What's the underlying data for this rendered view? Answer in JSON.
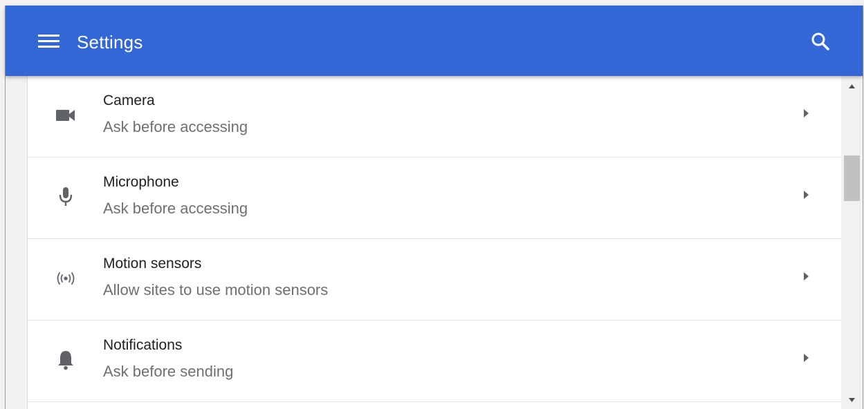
{
  "appbar": {
    "title": "Settings",
    "menu_icon": "hamburger-menu-icon",
    "search_icon": "search-icon",
    "color": "#3367d6"
  },
  "settings": [
    {
      "title": "Camera",
      "subtitle": "Ask before accessing",
      "icon": "camera-icon"
    },
    {
      "title": "Microphone",
      "subtitle": "Ask before accessing",
      "icon": "microphone-icon"
    },
    {
      "title": "Motion sensors",
      "subtitle": "Allow sites to use motion sensors",
      "icon": "motion-sensors-icon"
    },
    {
      "title": "Notifications",
      "subtitle": "Ask before sending",
      "icon": "bell-icon"
    }
  ],
  "scrollbar": {
    "up_icon": "scroll-up-arrow-icon",
    "down_icon": "scroll-down-arrow-icon"
  }
}
